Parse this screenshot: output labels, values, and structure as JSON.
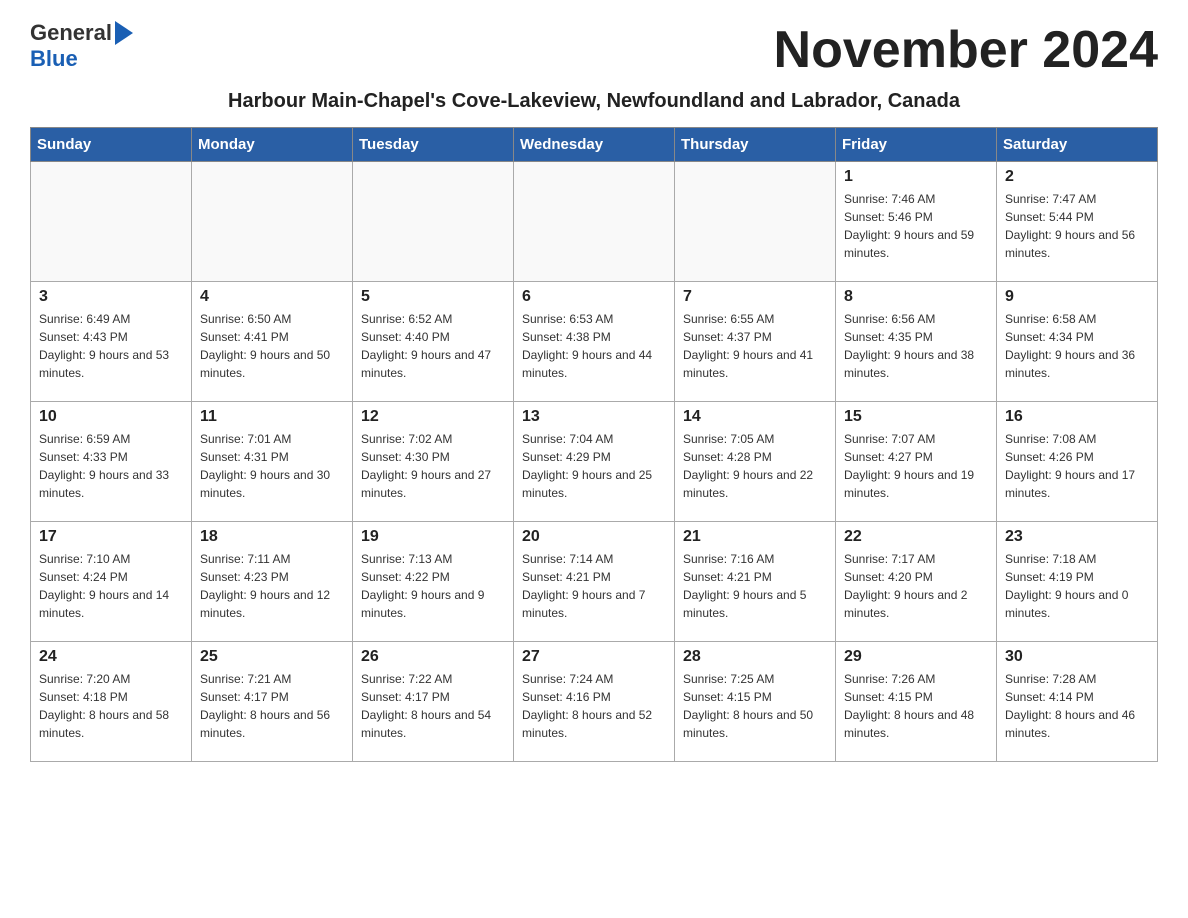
{
  "header": {
    "logo_general": "General",
    "logo_blue": "Blue",
    "month_title": "November 2024",
    "subtitle": "Harbour Main-Chapel's Cove-Lakeview, Newfoundland and Labrador, Canada"
  },
  "weekdays": [
    "Sunday",
    "Monday",
    "Tuesday",
    "Wednesday",
    "Thursday",
    "Friday",
    "Saturday"
  ],
  "weeks": [
    [
      {
        "day": "",
        "info": ""
      },
      {
        "day": "",
        "info": ""
      },
      {
        "day": "",
        "info": ""
      },
      {
        "day": "",
        "info": ""
      },
      {
        "day": "",
        "info": ""
      },
      {
        "day": "1",
        "info": "Sunrise: 7:46 AM\nSunset: 5:46 PM\nDaylight: 9 hours and 59 minutes."
      },
      {
        "day": "2",
        "info": "Sunrise: 7:47 AM\nSunset: 5:44 PM\nDaylight: 9 hours and 56 minutes."
      }
    ],
    [
      {
        "day": "3",
        "info": "Sunrise: 6:49 AM\nSunset: 4:43 PM\nDaylight: 9 hours and 53 minutes."
      },
      {
        "day": "4",
        "info": "Sunrise: 6:50 AM\nSunset: 4:41 PM\nDaylight: 9 hours and 50 minutes."
      },
      {
        "day": "5",
        "info": "Sunrise: 6:52 AM\nSunset: 4:40 PM\nDaylight: 9 hours and 47 minutes."
      },
      {
        "day": "6",
        "info": "Sunrise: 6:53 AM\nSunset: 4:38 PM\nDaylight: 9 hours and 44 minutes."
      },
      {
        "day": "7",
        "info": "Sunrise: 6:55 AM\nSunset: 4:37 PM\nDaylight: 9 hours and 41 minutes."
      },
      {
        "day": "8",
        "info": "Sunrise: 6:56 AM\nSunset: 4:35 PM\nDaylight: 9 hours and 38 minutes."
      },
      {
        "day": "9",
        "info": "Sunrise: 6:58 AM\nSunset: 4:34 PM\nDaylight: 9 hours and 36 minutes."
      }
    ],
    [
      {
        "day": "10",
        "info": "Sunrise: 6:59 AM\nSunset: 4:33 PM\nDaylight: 9 hours and 33 minutes."
      },
      {
        "day": "11",
        "info": "Sunrise: 7:01 AM\nSunset: 4:31 PM\nDaylight: 9 hours and 30 minutes."
      },
      {
        "day": "12",
        "info": "Sunrise: 7:02 AM\nSunset: 4:30 PM\nDaylight: 9 hours and 27 minutes."
      },
      {
        "day": "13",
        "info": "Sunrise: 7:04 AM\nSunset: 4:29 PM\nDaylight: 9 hours and 25 minutes."
      },
      {
        "day": "14",
        "info": "Sunrise: 7:05 AM\nSunset: 4:28 PM\nDaylight: 9 hours and 22 minutes."
      },
      {
        "day": "15",
        "info": "Sunrise: 7:07 AM\nSunset: 4:27 PM\nDaylight: 9 hours and 19 minutes."
      },
      {
        "day": "16",
        "info": "Sunrise: 7:08 AM\nSunset: 4:26 PM\nDaylight: 9 hours and 17 minutes."
      }
    ],
    [
      {
        "day": "17",
        "info": "Sunrise: 7:10 AM\nSunset: 4:24 PM\nDaylight: 9 hours and 14 minutes."
      },
      {
        "day": "18",
        "info": "Sunrise: 7:11 AM\nSunset: 4:23 PM\nDaylight: 9 hours and 12 minutes."
      },
      {
        "day": "19",
        "info": "Sunrise: 7:13 AM\nSunset: 4:22 PM\nDaylight: 9 hours and 9 minutes."
      },
      {
        "day": "20",
        "info": "Sunrise: 7:14 AM\nSunset: 4:21 PM\nDaylight: 9 hours and 7 minutes."
      },
      {
        "day": "21",
        "info": "Sunrise: 7:16 AM\nSunset: 4:21 PM\nDaylight: 9 hours and 5 minutes."
      },
      {
        "day": "22",
        "info": "Sunrise: 7:17 AM\nSunset: 4:20 PM\nDaylight: 9 hours and 2 minutes."
      },
      {
        "day": "23",
        "info": "Sunrise: 7:18 AM\nSunset: 4:19 PM\nDaylight: 9 hours and 0 minutes."
      }
    ],
    [
      {
        "day": "24",
        "info": "Sunrise: 7:20 AM\nSunset: 4:18 PM\nDaylight: 8 hours and 58 minutes."
      },
      {
        "day": "25",
        "info": "Sunrise: 7:21 AM\nSunset: 4:17 PM\nDaylight: 8 hours and 56 minutes."
      },
      {
        "day": "26",
        "info": "Sunrise: 7:22 AM\nSunset: 4:17 PM\nDaylight: 8 hours and 54 minutes."
      },
      {
        "day": "27",
        "info": "Sunrise: 7:24 AM\nSunset: 4:16 PM\nDaylight: 8 hours and 52 minutes."
      },
      {
        "day": "28",
        "info": "Sunrise: 7:25 AM\nSunset: 4:15 PM\nDaylight: 8 hours and 50 minutes."
      },
      {
        "day": "29",
        "info": "Sunrise: 7:26 AM\nSunset: 4:15 PM\nDaylight: 8 hours and 48 minutes."
      },
      {
        "day": "30",
        "info": "Sunrise: 7:28 AM\nSunset: 4:14 PM\nDaylight: 8 hours and 46 minutes."
      }
    ]
  ]
}
